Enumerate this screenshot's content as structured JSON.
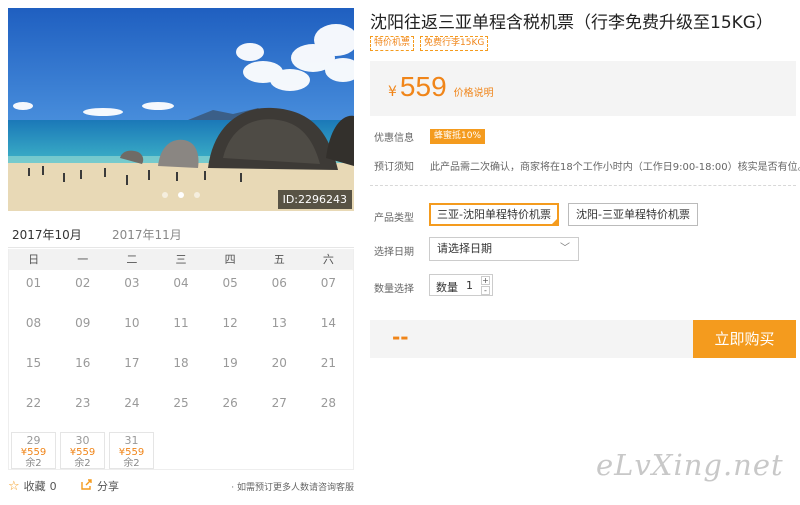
{
  "gallery": {
    "image_id": "ID:2296243",
    "slide_count": 3,
    "active_slide": 2
  },
  "calendar": {
    "months": [
      "2017年10月",
      "2017年11月"
    ],
    "active_month": "2017年10月",
    "weekdays": [
      "日",
      "一",
      "二",
      "三",
      "四",
      "五",
      "六"
    ],
    "weeks": [
      [
        "01",
        "02",
        "03",
        "04",
        "05",
        "06",
        "07"
      ],
      [
        "08",
        "09",
        "10",
        "11",
        "12",
        "13",
        "14"
      ],
      [
        "15",
        "16",
        "17",
        "18",
        "19",
        "20",
        "21"
      ],
      [
        "22",
        "23",
        "24",
        "25",
        "26",
        "27",
        "28"
      ]
    ],
    "priced_days": [
      {
        "day": "29",
        "price": "¥559",
        "remain": "余2"
      },
      {
        "day": "30",
        "price": "¥559",
        "remain": "余2"
      },
      {
        "day": "31",
        "price": "¥559",
        "remain": "余2"
      }
    ]
  },
  "actions": {
    "favorite_label": "收藏",
    "favorite_count": "0",
    "share_label": "分享",
    "group_note": "· 如需预订更多人数请咨询客服"
  },
  "product": {
    "title": "沈阳往返三亚单程含税机票（行李免费升级至15KG）",
    "tags": [
      "特价机票",
      "免费行李15KG"
    ],
    "currency": "¥",
    "price": "559",
    "price_explain": "价格说明",
    "promo_label": "优惠信息",
    "promo_value": "蜂蜜抵10%",
    "notice_label": "预订须知",
    "notice_text": "此产品需二次确认，商家将在18个工作小时内（工作日9:00-18:00）核实是否有位。",
    "type_label": "产品类型",
    "type_options": [
      "三亚-沈阳单程特价机票",
      "沈阳-三亚单程特价机票"
    ],
    "type_selected": 0,
    "date_label": "选择日期",
    "date_placeholder": "请选择日期",
    "qty_label": "数量选择",
    "qty_text": "数量",
    "qty_value": "1",
    "qty_plus": "+",
    "qty_minus": "-",
    "total": "--",
    "buy_label": "立即购买"
  },
  "watermark": "eLvXing.net",
  "colors": {
    "accent": "#f49b1e",
    "price": "#f08519"
  },
  "icons": {
    "favorite": "star-icon",
    "share": "share-icon",
    "dropdown": "chevron-down-icon"
  }
}
